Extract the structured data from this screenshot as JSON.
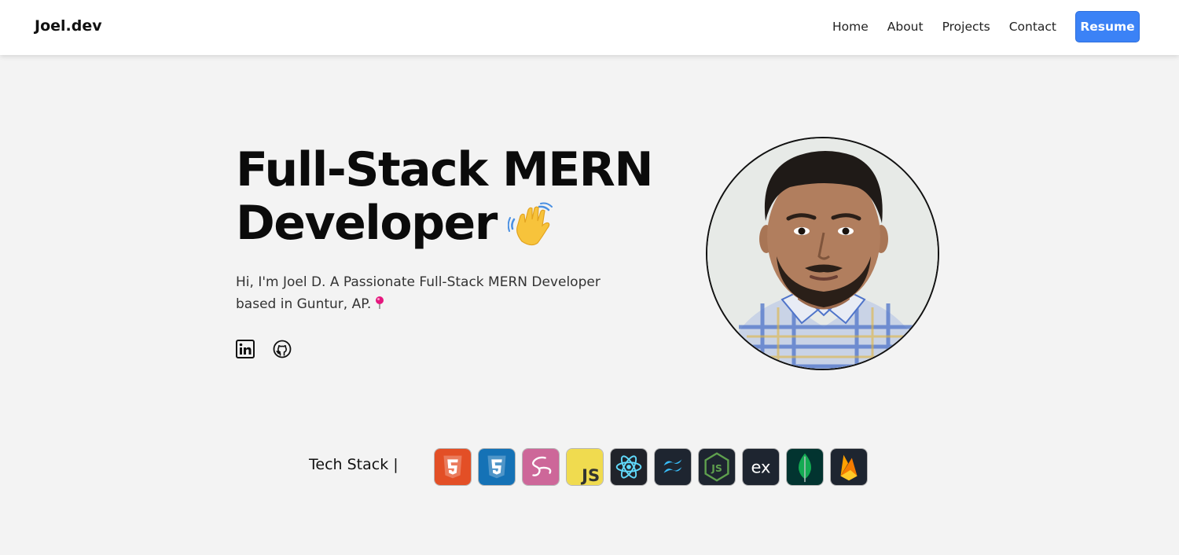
{
  "navbar": {
    "brand": "Joel.dev",
    "links": [
      "Home",
      "About",
      "Projects",
      "Contact"
    ],
    "resume_label": "Resume",
    "accent": "#3b82f6"
  },
  "hero": {
    "title_line1": "Full-Stack MERN",
    "title_line2": "Developer",
    "wave_icon": "waving-hand-icon",
    "intro_line1": "Hi, I'm Joel D. A Passionate Full-Stack MERN Developer",
    "intro_line2": "based in Guntur, AP.",
    "pin_icon": "pushpin-icon",
    "social": [
      "linkedin-icon",
      "github-icon"
    ],
    "avatar": "profile-photo"
  },
  "tech_stack": {
    "label": "Tech Stack |",
    "icons": [
      "html5-icon",
      "css3-icon",
      "sass-icon",
      "javascript-icon",
      "react-icon",
      "tailwind-icon",
      "nodejs-icon",
      "express-icon",
      "mongodb-icon",
      "firebase-icon"
    ],
    "js_text": "JS",
    "express_text": "ex",
    "node_text": "JS"
  }
}
